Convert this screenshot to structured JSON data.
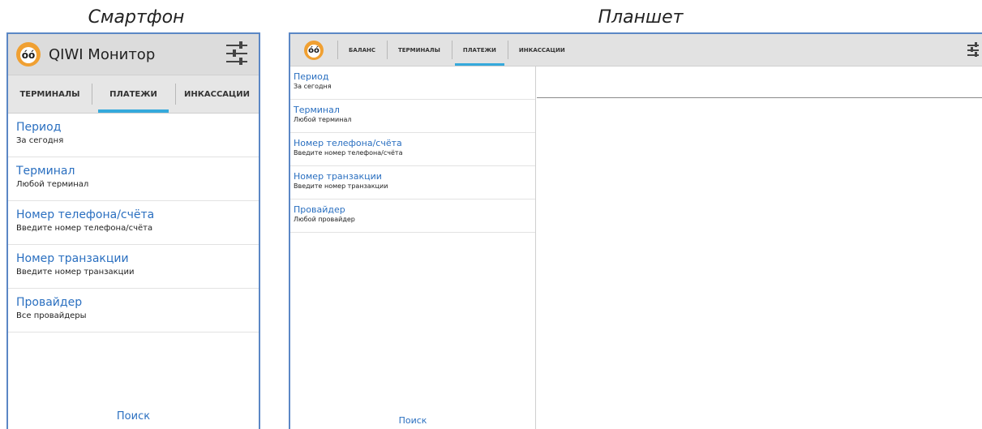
{
  "captions": {
    "phone": "Смартфон",
    "tablet": "Планшет"
  },
  "phone": {
    "app_title": "QIWI Монитор",
    "tabs": [
      {
        "label": "ТЕРМИНАЛЫ"
      },
      {
        "label": "ПЛАТЕЖИ",
        "active": true
      },
      {
        "label": "ИНКАССАЦИИ"
      }
    ],
    "items": [
      {
        "title": "Период",
        "subtitle": "За сегодня"
      },
      {
        "title": "Терминал",
        "subtitle": "Любой терминал"
      },
      {
        "title": "Номер телефона/счёта",
        "subtitle": "Введите номер телефона/счёта"
      },
      {
        "title": "Номер транзакции",
        "subtitle": "Введите номер транзакции"
      },
      {
        "title": "Провайдер",
        "subtitle": "Все провайдеры"
      }
    ],
    "search_label": "Поиск"
  },
  "tablet": {
    "tabs": [
      {
        "label": "БАЛАНС"
      },
      {
        "label": "ТЕРМИНАЛЫ"
      },
      {
        "label": "ПЛАТЕЖИ",
        "active": true
      },
      {
        "label": "ИНКАССАЦИИ"
      }
    ],
    "items": [
      {
        "title": "Период",
        "subtitle": "За сегодня"
      },
      {
        "title": "Терминал",
        "subtitle": "Любой терминал"
      },
      {
        "title": "Номер телефона/счёта",
        "subtitle": "Введите номер телефона/счёта"
      },
      {
        "title": "Номер транзакции",
        "subtitle": "Введите номер транзакции"
      },
      {
        "title": "Провайдер",
        "subtitle": "Любой провайдер"
      }
    ],
    "search_label": "Поиск"
  },
  "icons": {
    "logo": "qiwi-logo-icon",
    "settings": "sliders-icon"
  },
  "colors": {
    "accent": "#35a9dc",
    "link": "#2a6fc0",
    "frame": "#5b87c5",
    "logo": "#f0a032"
  }
}
